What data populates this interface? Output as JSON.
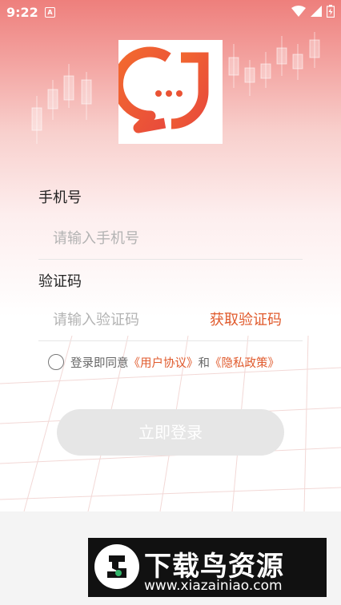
{
  "status_bar": {
    "time": "9:22",
    "notification_glyph": "A"
  },
  "form": {
    "phone_label": "手机号",
    "phone_placeholder": "请输入手机号",
    "code_label": "验证码",
    "code_placeholder": "请输入验证码",
    "get_code_label": "获取验证码"
  },
  "agreement": {
    "prefix": "登录即同意",
    "user_agreement": "《用户协议》",
    "and": "和",
    "privacy_policy": "《隐私政策》"
  },
  "login_button": {
    "label": "立即登录"
  },
  "watermark": {
    "title": "下载鸟资源",
    "url": "www.xiazainiao.com"
  },
  "colors": {
    "accent": "#e05a2c",
    "button_disabled": "#e6e6e6",
    "header_gradient_top": "#ee7f7c"
  },
  "icons": [
    "wifi-icon",
    "cell-signal-icon",
    "battery-icon",
    "app-logo-icon",
    "radio-unchecked-icon",
    "bird-logo-icon"
  ]
}
